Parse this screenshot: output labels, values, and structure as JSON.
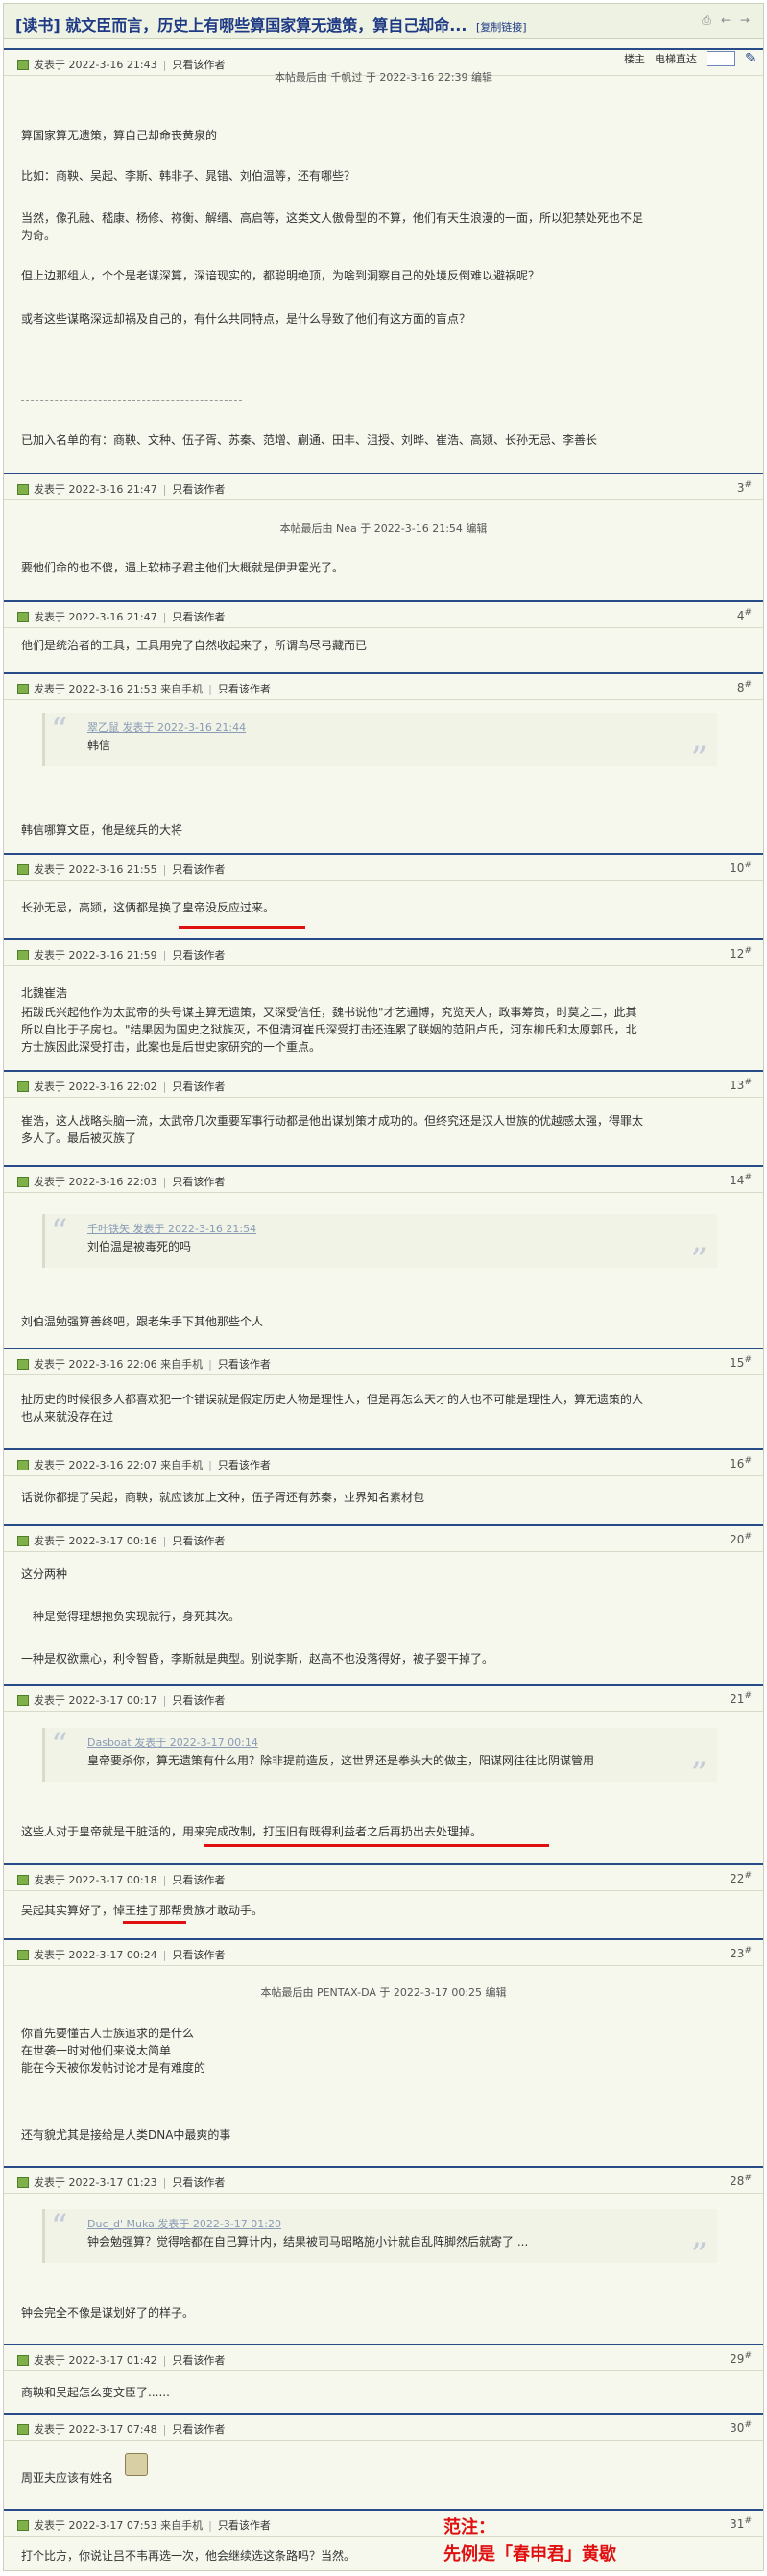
{
  "thread": {
    "title": "[读书] 就文臣而言，历史上有哪些算国家算无遗策，算自己却命...",
    "copy_link": "[复制链接]"
  },
  "toolbar": {
    "landlord": "楼主",
    "electric": "电梯直达"
  },
  "posts": [
    {
      "date": "发表于 2022-3-16 21:43",
      "only": "只看该作者",
      "edit": "本帖最后由 千帆过 于 2022-3-16 22:39 编辑",
      "lines": [
        "算国家算无遗策，算自己却命丧黄泉的",
        "比如：商鞅、吴起、李斯、韩非子、晁错、刘伯温等，还有哪些？",
        "当然，像孔融、嵇康、杨修、祢衡、解缙、高启等，这类文人傲骨型的不算，他们有天生浪漫的一面，所以犯禁处死也不足",
        "为奇。",
        "但上边那组人，个个是老谋深算，深谙现实的，都聪明绝顶，为啥到洞察自己的处境反倒难以避祸呢？",
        "或者这些谋略深远却祸及自己的，有什么共同特点，是什么导致了他们有这方面的盲点？",
        "已加入名单的有：商鞅、文种、伍子胥、苏秦、范增、蒯通、田丰、沮授、刘晔、崔浩、高颎、长孙无忌、李善长"
      ]
    },
    {
      "date": "发表于 2022-3-16 21:47",
      "only": "只看该作者",
      "floor": "3",
      "edit": "本帖最后由 Nea 于 2022-3-16 21:54 编辑",
      "lines": [
        "要他们命的也不傻，遇上软柿子君主他们大概就是伊尹霍光了。"
      ]
    },
    {
      "date": "发表于 2022-3-16 21:47",
      "only": "只看该作者",
      "floor": "4",
      "lines": [
        "他们是统治者的工具，工具用完了自然收起来了，所谓鸟尽弓藏而已"
      ]
    },
    {
      "date": "发表于 2022-3-16 21:53 来自手机",
      "only": "只看该作者",
      "floor": "8",
      "quote_head": "翠乙鼠 发表于 2022-3-16 21:44",
      "quote_text": "韩信",
      "lines": [
        "韩信哪算文臣，他是统兵的大将"
      ]
    },
    {
      "date": "发表于 2022-3-16 21:55",
      "only": "只看该作者",
      "floor": "10",
      "lines": [
        "长孙无忌，高颎，这俩都是换了皇帝没反应过来。"
      ]
    },
    {
      "date": "发表于 2022-3-16 21:59",
      "only": "只看该作者",
      "floor": "12",
      "lines": [
        "北魏崔浩",
        "拓跋氏兴起他作为太武帝的头号谋主算无遗策，又深受信任，魏书说他\"才艺通博，究览天人，政事筹策，时莫之二，此其",
        "所以自比于子房也。\"结果因为国史之狱族灭，不但清河崔氏深受打击还连累了联姻的范阳卢氏，河东柳氏和太原郭氏，北",
        "方士族因此深受打击，此案也是后世史家研究的一个重点。"
      ]
    },
    {
      "date": "发表于 2022-3-16 22:02",
      "only": "只看该作者",
      "floor": "13",
      "lines": [
        "崔浩，这人战略头脑一流，太武帝几次重要军事行动都是他出谋划策才成功的。但终究还是汉人世族的优越感太强，得罪太",
        "多人了。最后被灭族了"
      ]
    },
    {
      "date": "发表于 2022-3-16 22:03",
      "only": "只看该作者",
      "floor": "14",
      "quote_head": "千叶铁矢 发表于 2022-3-16 21:54",
      "quote_text": "刘伯温是被毒死的吗",
      "lines": [
        "刘伯温勉强算善终吧，跟老朱手下其他那些个人"
      ]
    },
    {
      "date": "发表于 2022-3-16 22:06 来自手机",
      "only": "只看该作者",
      "floor": "15",
      "lines": [
        "扯历史的时候很多人都喜欢犯一个错误就是假定历史人物是理性人，但是再怎么天才的人也不可能是理性人，算无遗策的人",
        "也从来就没存在过"
      ]
    },
    {
      "date": "发表于 2022-3-16 22:07 来自手机",
      "only": "只看该作者",
      "floor": "16",
      "lines": [
        "话说你都提了吴起，商鞅，就应该加上文种，伍子胥还有苏秦，业界知名素材包"
      ]
    },
    {
      "date": "发表于 2022-3-17 00:16",
      "only": "只看该作者",
      "floor": "20",
      "lines": [
        "这分两种",
        "一种是觉得理想抱负实现就行，身死其次。",
        "一种是权欲熏心，利令智昏，李斯就是典型。别说李斯，赵高不也没落得好，被子婴干掉了。"
      ]
    },
    {
      "date": "发表于 2022-3-17 00:17",
      "only": "只看该作者",
      "floor": "21",
      "quote_head": "Dasboat 发表于 2022-3-17 00:14",
      "quote_text": "皇帝要杀你，算无遗策有什么用？除非提前造反，这世界还是拳头大的做主，阳谋网往往比阴谋管用",
      "lines": [
        "这些人对于皇帝就是干脏活的，用来完成改制，打压旧有既得利益者之后再扔出去处理掉。"
      ]
    },
    {
      "date": "发表于 2022-3-17 00:18",
      "only": "只看该作者",
      "floor": "22",
      "lines": [
        "吴起其实算好了，悼王挂了那帮贵族才敢动手。"
      ]
    },
    {
      "date": "发表于 2022-3-17 00:24",
      "only": "只看该作者",
      "floor": "23",
      "edit": "本帖最后由 PENTAX-DA 于 2022-3-17 00:25 编辑",
      "lines": [
        "你首先要懂古人士族追求的是什么",
        "在世袭一时对他们来说太简单",
        "能在今天被你发帖讨论才是有难度的",
        "还有貌尤其是接给是人类DNA中最爽的事"
      ]
    },
    {
      "date": "发表于 2022-3-17 01:23",
      "only": "只看该作者",
      "floor": "28",
      "quote_head": "Duc_d' Muka 发表于 2022-3-17 01:20",
      "quote_text": "钟会勉强算？觉得啥都在自己算计内，结果被司马昭略施小计就自乱阵脚然后就寄了 ...",
      "lines": [
        "钟会完全不像是谋划好了的样子。"
      ]
    },
    {
      "date": "发表于 2022-3-17 01:42",
      "only": "只看该作者",
      "floor": "29",
      "lines": [
        "商鞅和吴起怎么变文臣了......"
      ]
    },
    {
      "date": "发表于 2022-3-17 07:48",
      "only": "只看该作者",
      "floor": "30",
      "lines": [
        "周亚夫应该有姓名"
      ]
    },
    {
      "date": "发表于 2022-3-17 07:53 来自手机",
      "only": "只看该作者",
      "floor": "31",
      "lines": [
        "打个比方，你说让吕不韦再选一次，他会继续选这条路吗？当然。"
      ]
    }
  ],
  "annotation": {
    "line1": "范注：",
    "line2": "先例是「春申君」黄歇"
  },
  "colors": {
    "accent": "#2a4b8a",
    "title": "#1f3a85",
    "underline": "#e01010"
  }
}
